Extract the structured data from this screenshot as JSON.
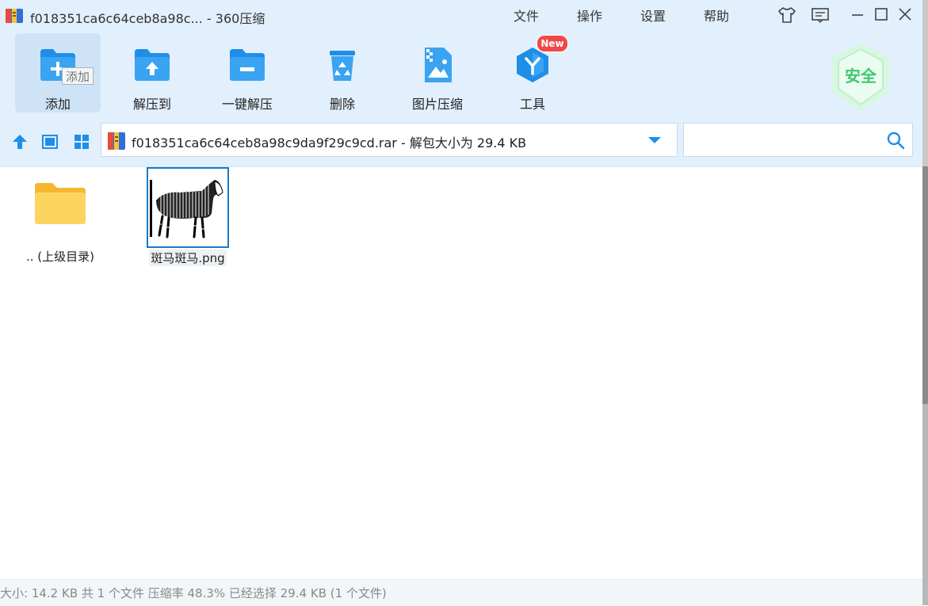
{
  "window": {
    "title": "f018351ca6c64ceb8a98c... - 360压缩",
    "menu": [
      "文件",
      "操作",
      "设置",
      "帮助"
    ]
  },
  "toolbar": {
    "tools": [
      {
        "label": "添加",
        "icon": "add-folder-icon"
      },
      {
        "label": "解压到",
        "icon": "extract-to-icon"
      },
      {
        "label": "一键解压",
        "icon": "one-click-extract-icon"
      },
      {
        "label": "删除",
        "icon": "recycle-bin-icon"
      },
      {
        "label": "图片压缩",
        "icon": "image-compress-icon"
      },
      {
        "label": "工具",
        "icon": "tools-icon"
      }
    ],
    "tooltip": "添加",
    "new_badge": "New",
    "security_badge": "安全"
  },
  "navigation": {
    "path": "f018351ca6c64ceb8a98c9da9f29c9cd.rar - 解包大小为 29.4 KB",
    "search_placeholder": ""
  },
  "files": [
    {
      "name": ".. (上级目录)",
      "icon": "folder-icon"
    },
    {
      "name": "斑马斑马.png",
      "icon": "zebra-image-thumbnail",
      "selected": true
    }
  ],
  "status": {
    "text": "大小: 14.2 KB 共 1 个文件 压缩率 48.3% 已经选择 29.4 KB (1 个文件)"
  },
  "colors": {
    "accent": "#1e8ee8",
    "chrome": "#e2effc",
    "security_green": "#3cc870",
    "badge_red": "#f04848"
  }
}
